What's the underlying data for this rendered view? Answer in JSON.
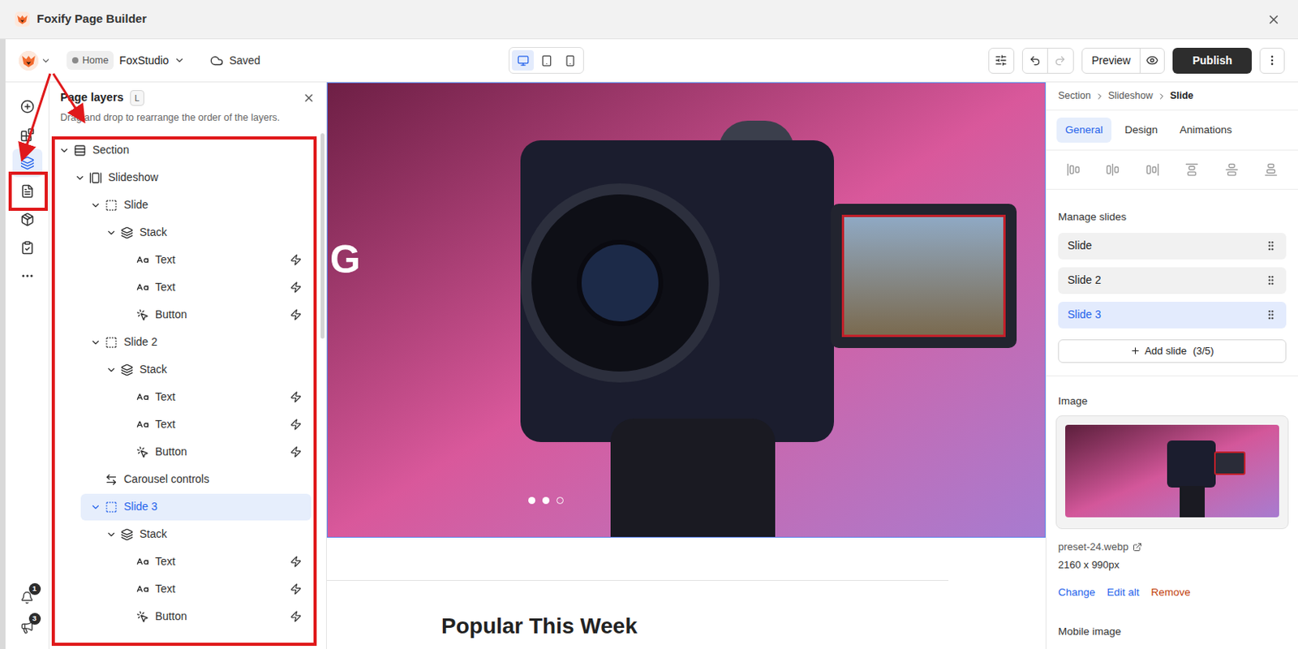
{
  "window": {
    "title": "Foxify Page Builder"
  },
  "toolbar": {
    "page_badge": "Home",
    "store": "FoxStudio",
    "save_status": "Saved",
    "devices": [
      {
        "kind": "desktop",
        "selected": true
      },
      {
        "kind": "tablet",
        "selected": false
      },
      {
        "kind": "mobile",
        "selected": false
      }
    ],
    "undo_enabled": true,
    "redo_enabled": false,
    "preview": "Preview",
    "publish": "Publish"
  },
  "rail": {
    "items": [
      {
        "kind": "add",
        "selected": false
      },
      {
        "kind": "elements",
        "selected": false
      },
      {
        "kind": "layers",
        "selected": true
      },
      {
        "kind": "pages",
        "selected": false
      },
      {
        "kind": "sections",
        "selected": false
      },
      {
        "kind": "checklist",
        "selected": false
      },
      {
        "kind": "more",
        "selected": false
      }
    ],
    "notifications": [
      {
        "kind": "bell",
        "badge": "1"
      },
      {
        "kind": "megaphone",
        "badge": "3"
      }
    ]
  },
  "layers_panel": {
    "title": "Page layers",
    "shortcut": "L",
    "hint": "Drag and drop to rearrange the order of the layers.",
    "layers": [
      {
        "label": "Section",
        "kind": "section",
        "depth": 0,
        "expandable": true,
        "expanded": true,
        "selected": false,
        "has_logic": false
      },
      {
        "label": "Slideshow",
        "kind": "slideshow",
        "depth": 1,
        "expandable": true,
        "expanded": true,
        "selected": false,
        "has_logic": false
      },
      {
        "label": "Slide",
        "kind": "slide",
        "depth": 2,
        "expandable": true,
        "expanded": true,
        "selected": false,
        "has_logic": false
      },
      {
        "label": "Stack",
        "kind": "stack",
        "depth": 3,
        "expandable": true,
        "expanded": true,
        "selected": false,
        "has_logic": false
      },
      {
        "label": "Text",
        "kind": "text",
        "depth": 4,
        "expandable": false,
        "expanded": false,
        "selected": false,
        "has_logic": true
      },
      {
        "label": "Text",
        "kind": "text",
        "depth": 4,
        "expandable": false,
        "expanded": false,
        "selected": false,
        "has_logic": true
      },
      {
        "label": "Button",
        "kind": "button",
        "depth": 4,
        "expandable": false,
        "expanded": false,
        "selected": false,
        "has_logic": true
      },
      {
        "label": "Slide 2",
        "kind": "slide",
        "depth": 2,
        "expandable": true,
        "expanded": true,
        "selected": false,
        "has_logic": false
      },
      {
        "label": "Stack",
        "kind": "stack",
        "depth": 3,
        "expandable": true,
        "expanded": true,
        "selected": false,
        "has_logic": false
      },
      {
        "label": "Text",
        "kind": "text",
        "depth": 4,
        "expandable": false,
        "expanded": false,
        "selected": false,
        "has_logic": true
      },
      {
        "label": "Text",
        "kind": "text",
        "depth": 4,
        "expandable": false,
        "expanded": false,
        "selected": false,
        "has_logic": true
      },
      {
        "label": "Button",
        "kind": "button",
        "depth": 4,
        "expandable": false,
        "expanded": false,
        "selected": false,
        "has_logic": true
      },
      {
        "label": "Carousel controls",
        "kind": "carousel-controls",
        "depth": 2,
        "expandable": false,
        "expanded": false,
        "selected": false,
        "has_logic": false
      },
      {
        "label": "Slide 3",
        "kind": "slide",
        "depth": 2,
        "expandable": true,
        "expanded": true,
        "selected": true,
        "has_logic": false
      },
      {
        "label": "Stack",
        "kind": "stack",
        "depth": 3,
        "expandable": true,
        "expanded": true,
        "selected": false,
        "has_logic": false
      },
      {
        "label": "Text",
        "kind": "text",
        "depth": 4,
        "expandable": false,
        "expanded": false,
        "selected": false,
        "has_logic": true
      },
      {
        "label": "Text",
        "kind": "text",
        "depth": 4,
        "expandable": false,
        "expanded": false,
        "selected": false,
        "has_logic": true
      },
      {
        "label": "Button",
        "kind": "button",
        "depth": 4,
        "expandable": false,
        "expanded": false,
        "selected": false,
        "has_logic": true
      }
    ]
  },
  "canvas": {
    "heading_fragment": "G",
    "slide_dots": [
      {
        "selected": false
      },
      {
        "selected": false
      },
      {
        "selected": true
      }
    ],
    "next_section_title": "Popular This Week"
  },
  "inspector": {
    "breadcrumb": [
      "Section",
      "Slideshow",
      "Slide"
    ],
    "tabs": [
      {
        "label": "General",
        "selected": true
      },
      {
        "label": "Design",
        "selected": false
      },
      {
        "label": "Animations",
        "selected": false
      }
    ],
    "manage_slides": {
      "title": "Manage slides",
      "slides": [
        {
          "label": "Slide",
          "selected": false
        },
        {
          "label": "Slide 2",
          "selected": false
        },
        {
          "label": "Slide 3",
          "selected": true
        }
      ],
      "add_button": "Add slide",
      "count": "(3/5)"
    },
    "image": {
      "title": "Image",
      "filename": "preset-24.webp",
      "dimensions": "2160 x 990px",
      "actions": [
        {
          "label": "Change",
          "color": "#2563eb"
        },
        {
          "label": "Edit alt",
          "color": "#2563eb"
        },
        {
          "label": "Remove",
          "color": "#c2410c"
        }
      ]
    },
    "mobile_image": {
      "title": "Mobile image"
    }
  }
}
